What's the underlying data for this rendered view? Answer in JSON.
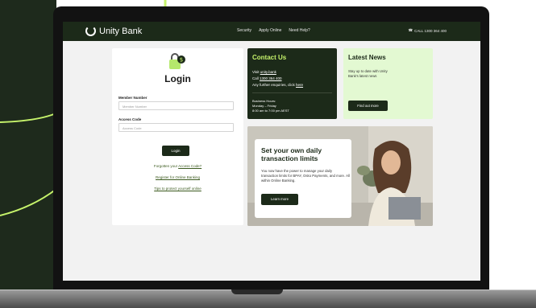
{
  "nav": {
    "brand": "Unity Bank",
    "links": [
      "Security",
      "Apply Online",
      "Need Help?"
    ],
    "call": "CALL 1300 364 400"
  },
  "login": {
    "title": "Login",
    "member_label": "Member Number",
    "member_placeholder": "Member Number",
    "access_label": "Access Code",
    "access_placeholder": "Access Code",
    "button": "Login",
    "forgot_prefix": "Forgotten your ",
    "forgot_link": "Access Code?",
    "register": "Register for Online Banking",
    "tips": "Tips to protect yourself online"
  },
  "contact": {
    "title": "Contact Us",
    "visit_prefix": "Visit ",
    "visit_link": "unity.bank",
    "call_prefix": "Call ",
    "call_link": "1300 364 400",
    "enquiries_prefix": "Any further enquiries, click ",
    "enquiries_link": "here",
    "hours_title": "Business Hours:",
    "hours_days": "Monday – Friday",
    "hours_time": "8:00 am to 7:00 pm AEST"
  },
  "news": {
    "title": "Latest News",
    "text": "Stay up to date with Unity Bank's latest news",
    "button": "Find out more"
  },
  "promo": {
    "title": "Set your own daily transaction limits",
    "text": "You now have the power to manage your daily transaction limits for BPAY, Osko Payments, and more. All within Online Banking.",
    "button": "Learn more"
  },
  "colors": {
    "brand_dark": "#1c2a19",
    "accent_lime": "#c6f36b",
    "news_bg": "#e3f9d2"
  }
}
